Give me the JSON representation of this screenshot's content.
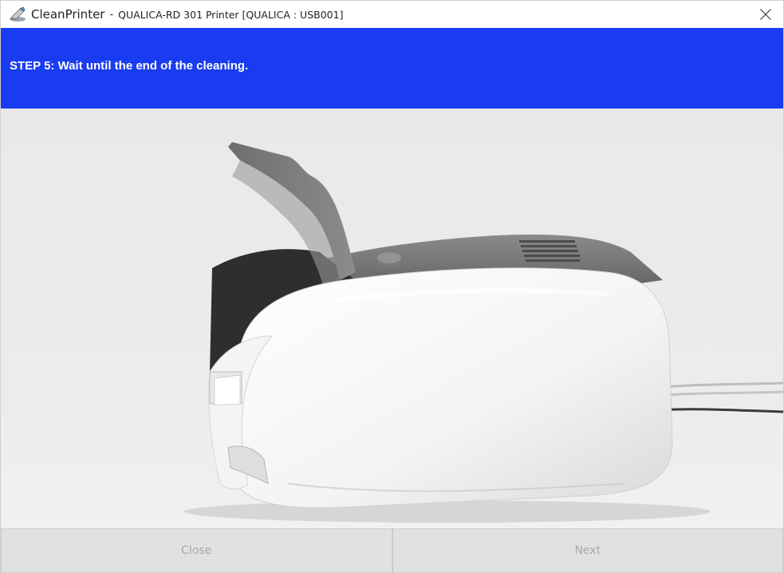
{
  "window": {
    "app_name": "CleanPrinter",
    "separator": "-",
    "title_detail": "QUALICA-RD 301 Printer [QUALICA : USB001]",
    "icons": {
      "app": "app-icon",
      "close": "close-icon"
    }
  },
  "banner": {
    "text": "STEP 5:  Wait until the end of the cleaning.",
    "color": "#1a3cf0"
  },
  "image": {
    "subject": "card printer with cover open"
  },
  "buttons": {
    "close_label": "Close",
    "next_label": "Next"
  }
}
